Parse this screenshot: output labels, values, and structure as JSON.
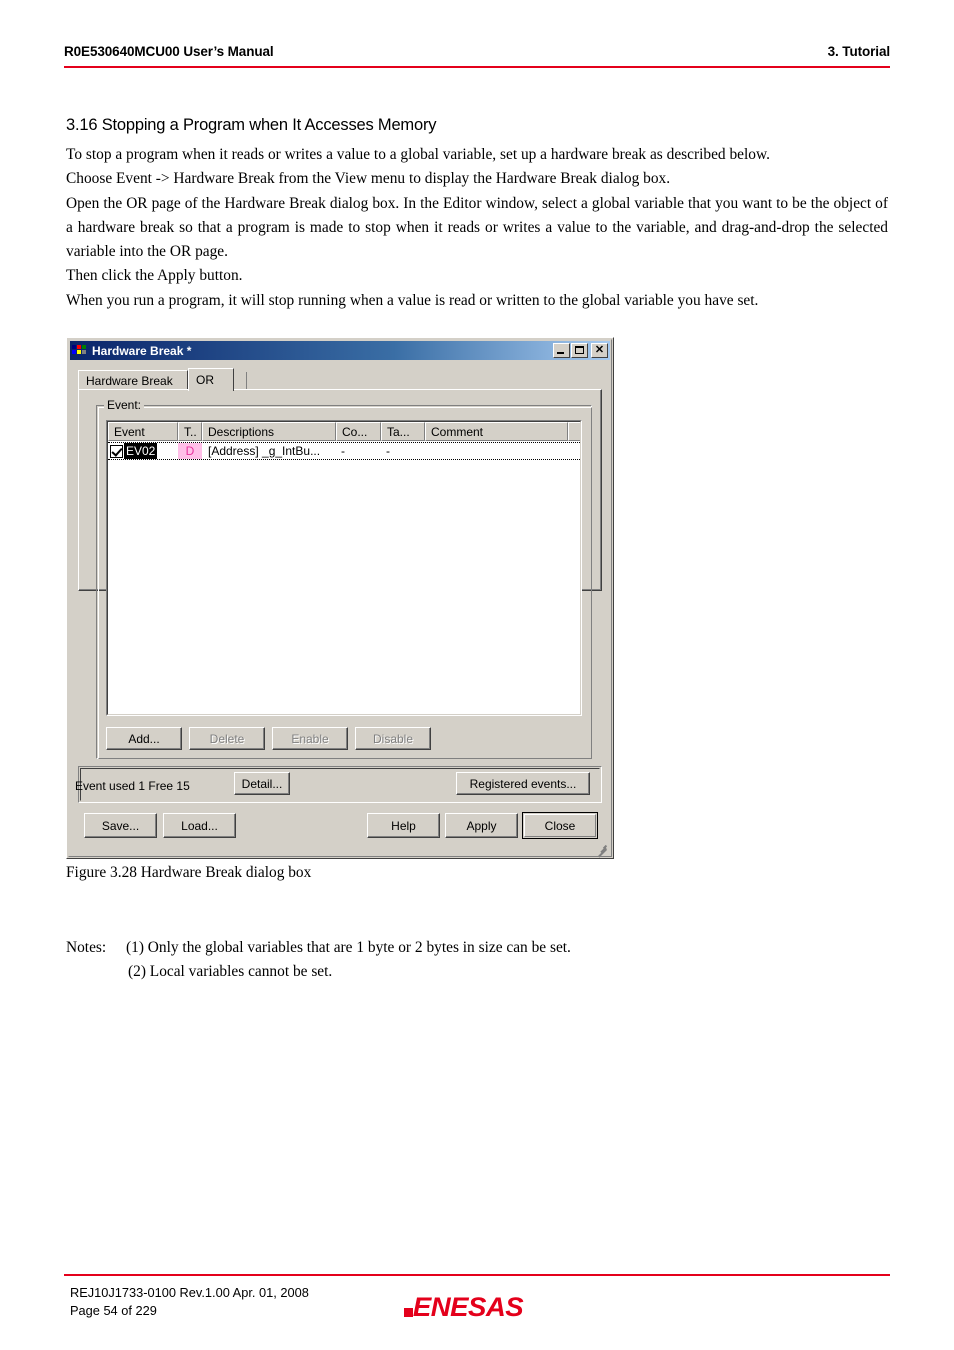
{
  "header": {
    "left": "R0E530640MCU00 User’s Manual",
    "right": "3. Tutorial",
    "rule_color": "#e4001b"
  },
  "section": {
    "title": "3.16 Stopping a Program when It Accesses Memory",
    "paragraphs": [
      "To stop a program when it reads or writes a value to a global variable, set up a hardware break as described below.",
      "Choose Event -> Hardware Break from the View menu to display the Hardware Break dialog box.",
      "Open the OR page of the Hardware Break dialog box. In the Editor window, select a global variable that you want to be the object of a hardware break so that a program is made to stop when it reads or writes a value to the variable, and drag-and-drop the selected variable into the OR page.",
      "Then click the Apply button.",
      "When you run a program, it will stop running when a value is read or written to the global variable you have set."
    ]
  },
  "dialog": {
    "title": "Hardware Break *",
    "icon": "app-grid-icon",
    "window_buttons": {
      "minimize": "_",
      "maximize": "□",
      "close": "✕"
    },
    "tabs": [
      {
        "label": "Hardware Break",
        "active": false
      },
      {
        "label": "OR",
        "active": true
      }
    ],
    "group": {
      "label": "Event:"
    },
    "listview": {
      "columns": [
        "Event",
        "T..",
        "Descriptions",
        "Co...",
        "Ta...",
        "Comment",
        ""
      ],
      "rows": [
        {
          "checked": true,
          "event": "EV02",
          "type": "D",
          "descriptions": "[Address] _g_IntBu...",
          "co": "-",
          "ta": "-",
          "comment": ""
        }
      ]
    },
    "list_buttons": [
      {
        "label": "Add...",
        "enabled": true
      },
      {
        "label": "Delete",
        "enabled": false
      },
      {
        "label": "Enable",
        "enabled": false
      },
      {
        "label": "Disable",
        "enabled": false
      }
    ],
    "status": {
      "text": "Event used   1  Free 15",
      "detail_label": "Detail...",
      "registered_label": "Registered events..."
    },
    "footer_buttons": {
      "save": "Save...",
      "load": "Load...",
      "help": "Help",
      "apply": "Apply",
      "close": "Close"
    }
  },
  "figure": {
    "caption": "Figure 3.28 Hardware Break dialog box"
  },
  "notes": {
    "label": "Notes:",
    "items": [
      "(1) Only the global variables that are 1 byte or 2 bytes in size can be set.",
      "(2) Local variables cannot be set."
    ]
  },
  "footer": {
    "doc_id": "REJ10J1733-0100   Rev.1.00   Apr. 01, 2008",
    "page": "Page 54 of 229",
    "logo_text": "ENESAS",
    "logo_color": "#e4001b"
  }
}
